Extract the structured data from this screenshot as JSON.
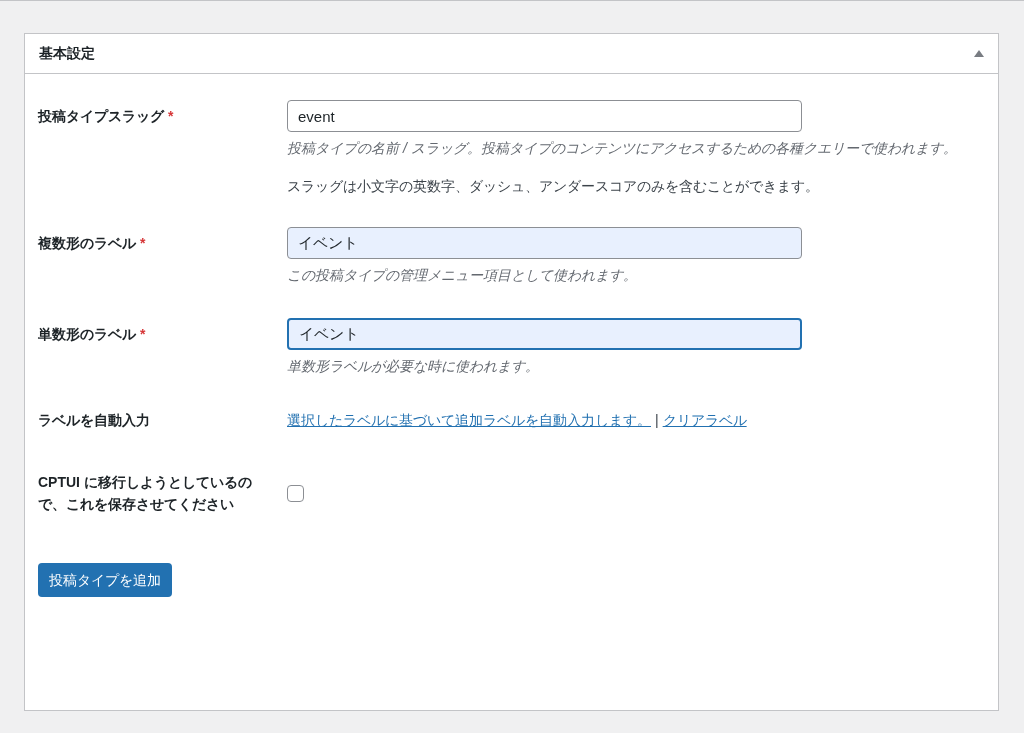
{
  "panel": {
    "title": "基本設定",
    "expanded": true
  },
  "rows": [
    {
      "kind": "text",
      "label": "投稿タイプスラッグ",
      "required_mark": "*",
      "value": "event",
      "autofilled": false,
      "focused": false,
      "description": "投稿タイプの名前 / スラッグ。投稿タイプのコンテンツにアクセスするための各種クエリーで使われます。",
      "note": "スラッグは小文字の英数字、ダッシュ、アンダースコアのみを含むことができます。"
    },
    {
      "kind": "text",
      "label": "複数形のラベル",
      "required_mark": "*",
      "value": "イベント",
      "autofilled": true,
      "focused": false,
      "description": "この投稿タイプの管理メニュー項目として使われます。"
    },
    {
      "kind": "text",
      "label": "単数形のラベル",
      "required_mark": "*",
      "value": "イベント",
      "autofilled": true,
      "focused": true,
      "description": "単数形ラベルが必要な時に使われます。"
    },
    {
      "kind": "links",
      "label": "ラベルを自動入力",
      "links": [
        "選択したラベルに基づいて追加ラベルを自動入力します。",
        "クリアラベル"
      ],
      "separator": "|"
    },
    {
      "kind": "checkbox",
      "label": "CPTUI に移行しようとしているので、これを保存させてください",
      "checked": false
    }
  ],
  "submit": "投稿タイプを追加"
}
